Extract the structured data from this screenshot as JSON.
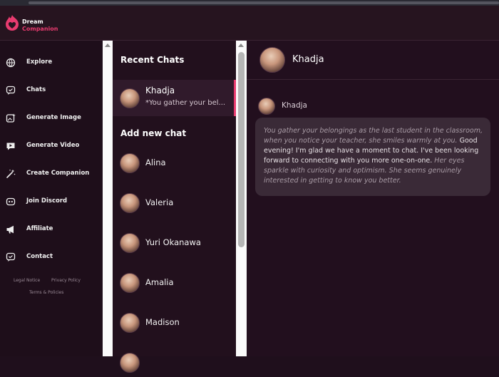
{
  "brand": {
    "name_line1": "Dream",
    "name_line2": "Companion",
    "accent_color": "#e83b6f"
  },
  "sidebar": {
    "items": [
      {
        "label": "Explore",
        "icon": "globe-icon"
      },
      {
        "label": "Chats",
        "icon": "chat-bubble-icon"
      },
      {
        "label": "Generate Image",
        "icon": "image-sparkle-icon"
      },
      {
        "label": "Generate Video",
        "icon": "video-icon"
      },
      {
        "label": "Create Companion",
        "icon": "magic-wand-icon"
      },
      {
        "label": "Join Discord",
        "icon": "discord-icon"
      },
      {
        "label": "Affiliate",
        "icon": "megaphone-icon"
      },
      {
        "label": "Contact",
        "icon": "contact-message-icon"
      }
    ],
    "footer": {
      "legal": "Legal Notice",
      "privacy": "Privacy Policy",
      "terms": "Terms & Policies"
    }
  },
  "chat_list": {
    "recent_title": "Recent Chats",
    "recent": {
      "name": "Khadja",
      "preview": "*You gather your bel..."
    },
    "add_new_title": "Add new chat",
    "contacts": [
      "Alina",
      "Valeria",
      "Yuri Okanawa",
      "Amalia",
      "Madison"
    ]
  },
  "chat": {
    "header_name": "Khadja",
    "sender_name": "Khadja",
    "message": {
      "italic_1": "You gather your belongings as the last student in the classroom, when you notice your teacher, she smiles warmly at you.",
      "normal": " Good evening! I'm glad we have a moment to chat. I've been looking forward to connecting with you more one-on-one. ",
      "italic_2": "Her eyes sparkle with curiosity and optimism. She seems genuinely interested in getting to know you better."
    }
  }
}
